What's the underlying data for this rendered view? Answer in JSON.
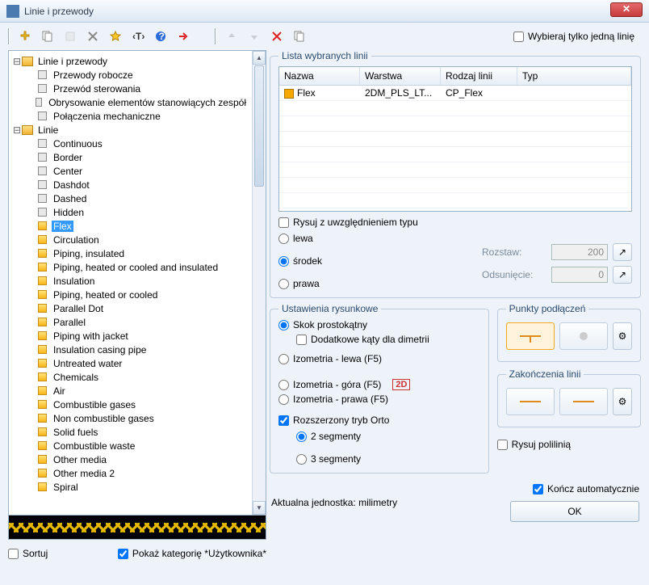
{
  "title": "Linie i przewody",
  "toolbar_right_checkbox": "Wybieraj tylko jedną linię",
  "tree": {
    "root1": "Linie i przewody",
    "root1_children": [
      "Przewody robocze",
      "Przewód sterowania",
      "Obrysowanie elementów stanowiących zespół",
      "Połączenia mechaniczne"
    ],
    "root2": "Linie",
    "root2_children": [
      "Continuous",
      "Border",
      "Center",
      "Dashdot",
      "Dashed",
      "Hidden",
      "Flex",
      "Circulation",
      "Piping, insulated",
      "Piping, heated or cooled and insulated",
      "Insulation",
      "Piping, heated or cooled",
      "Parallel Dot",
      "Parallel",
      "Piping with jacket",
      "Insulation casing pipe",
      "Untreated water",
      "Chemicals",
      "Air",
      "Combustible gases",
      "Non combustible gases",
      "Solid fuels",
      "Combustible waste",
      "Other media",
      "Other media 2",
      "Spiral"
    ],
    "selected": "Flex",
    "yellow_start_index": 6
  },
  "leftbot": {
    "sort": "Sortuj",
    "showcat": "Pokaż kategorię *Użytkownika*"
  },
  "list": {
    "legend": "Lista wybranych linii",
    "headers": [
      "Nazwa",
      "Warstwa",
      "Rodzaj linii",
      "Typ"
    ],
    "rows": [
      {
        "name": "Flex",
        "layer": "2DM_PLS_LT...",
        "kind": "CP_Flex",
        "type": ""
      }
    ],
    "draw_with_type": "Rysuj z uwzględnieniem typu",
    "align": {
      "left": "lewa",
      "center": "środek",
      "right": "prawa"
    },
    "spacing_label": "Rozstaw:",
    "spacing_val": "200",
    "offset_label": "Odsunięcie:",
    "offset_val": "0"
  },
  "draw": {
    "legend": "Ustawienia rysunkowe",
    "r1": "Skok prostokątny",
    "chk": "Dodatkowe kąty dla dimetrii",
    "r2": "Izometria - lewa (F5)",
    "r3": "Izometria - góra (F5)",
    "r4": "Izometria - prawa (F5)",
    "badge": "2D",
    "ortho": "Rozszerzony tryb Orto",
    "seg2": "2 segmenty",
    "seg3": "3 segmenty"
  },
  "pts": {
    "legend": "Punkty podłączeń"
  },
  "ends": {
    "legend": "Zakończenia linii"
  },
  "polyline": "Rysuj polilinią",
  "unit_label": "Aktualna jednostka: milimetry",
  "autoend": "Kończ automatycznie",
  "ok": "OK"
}
